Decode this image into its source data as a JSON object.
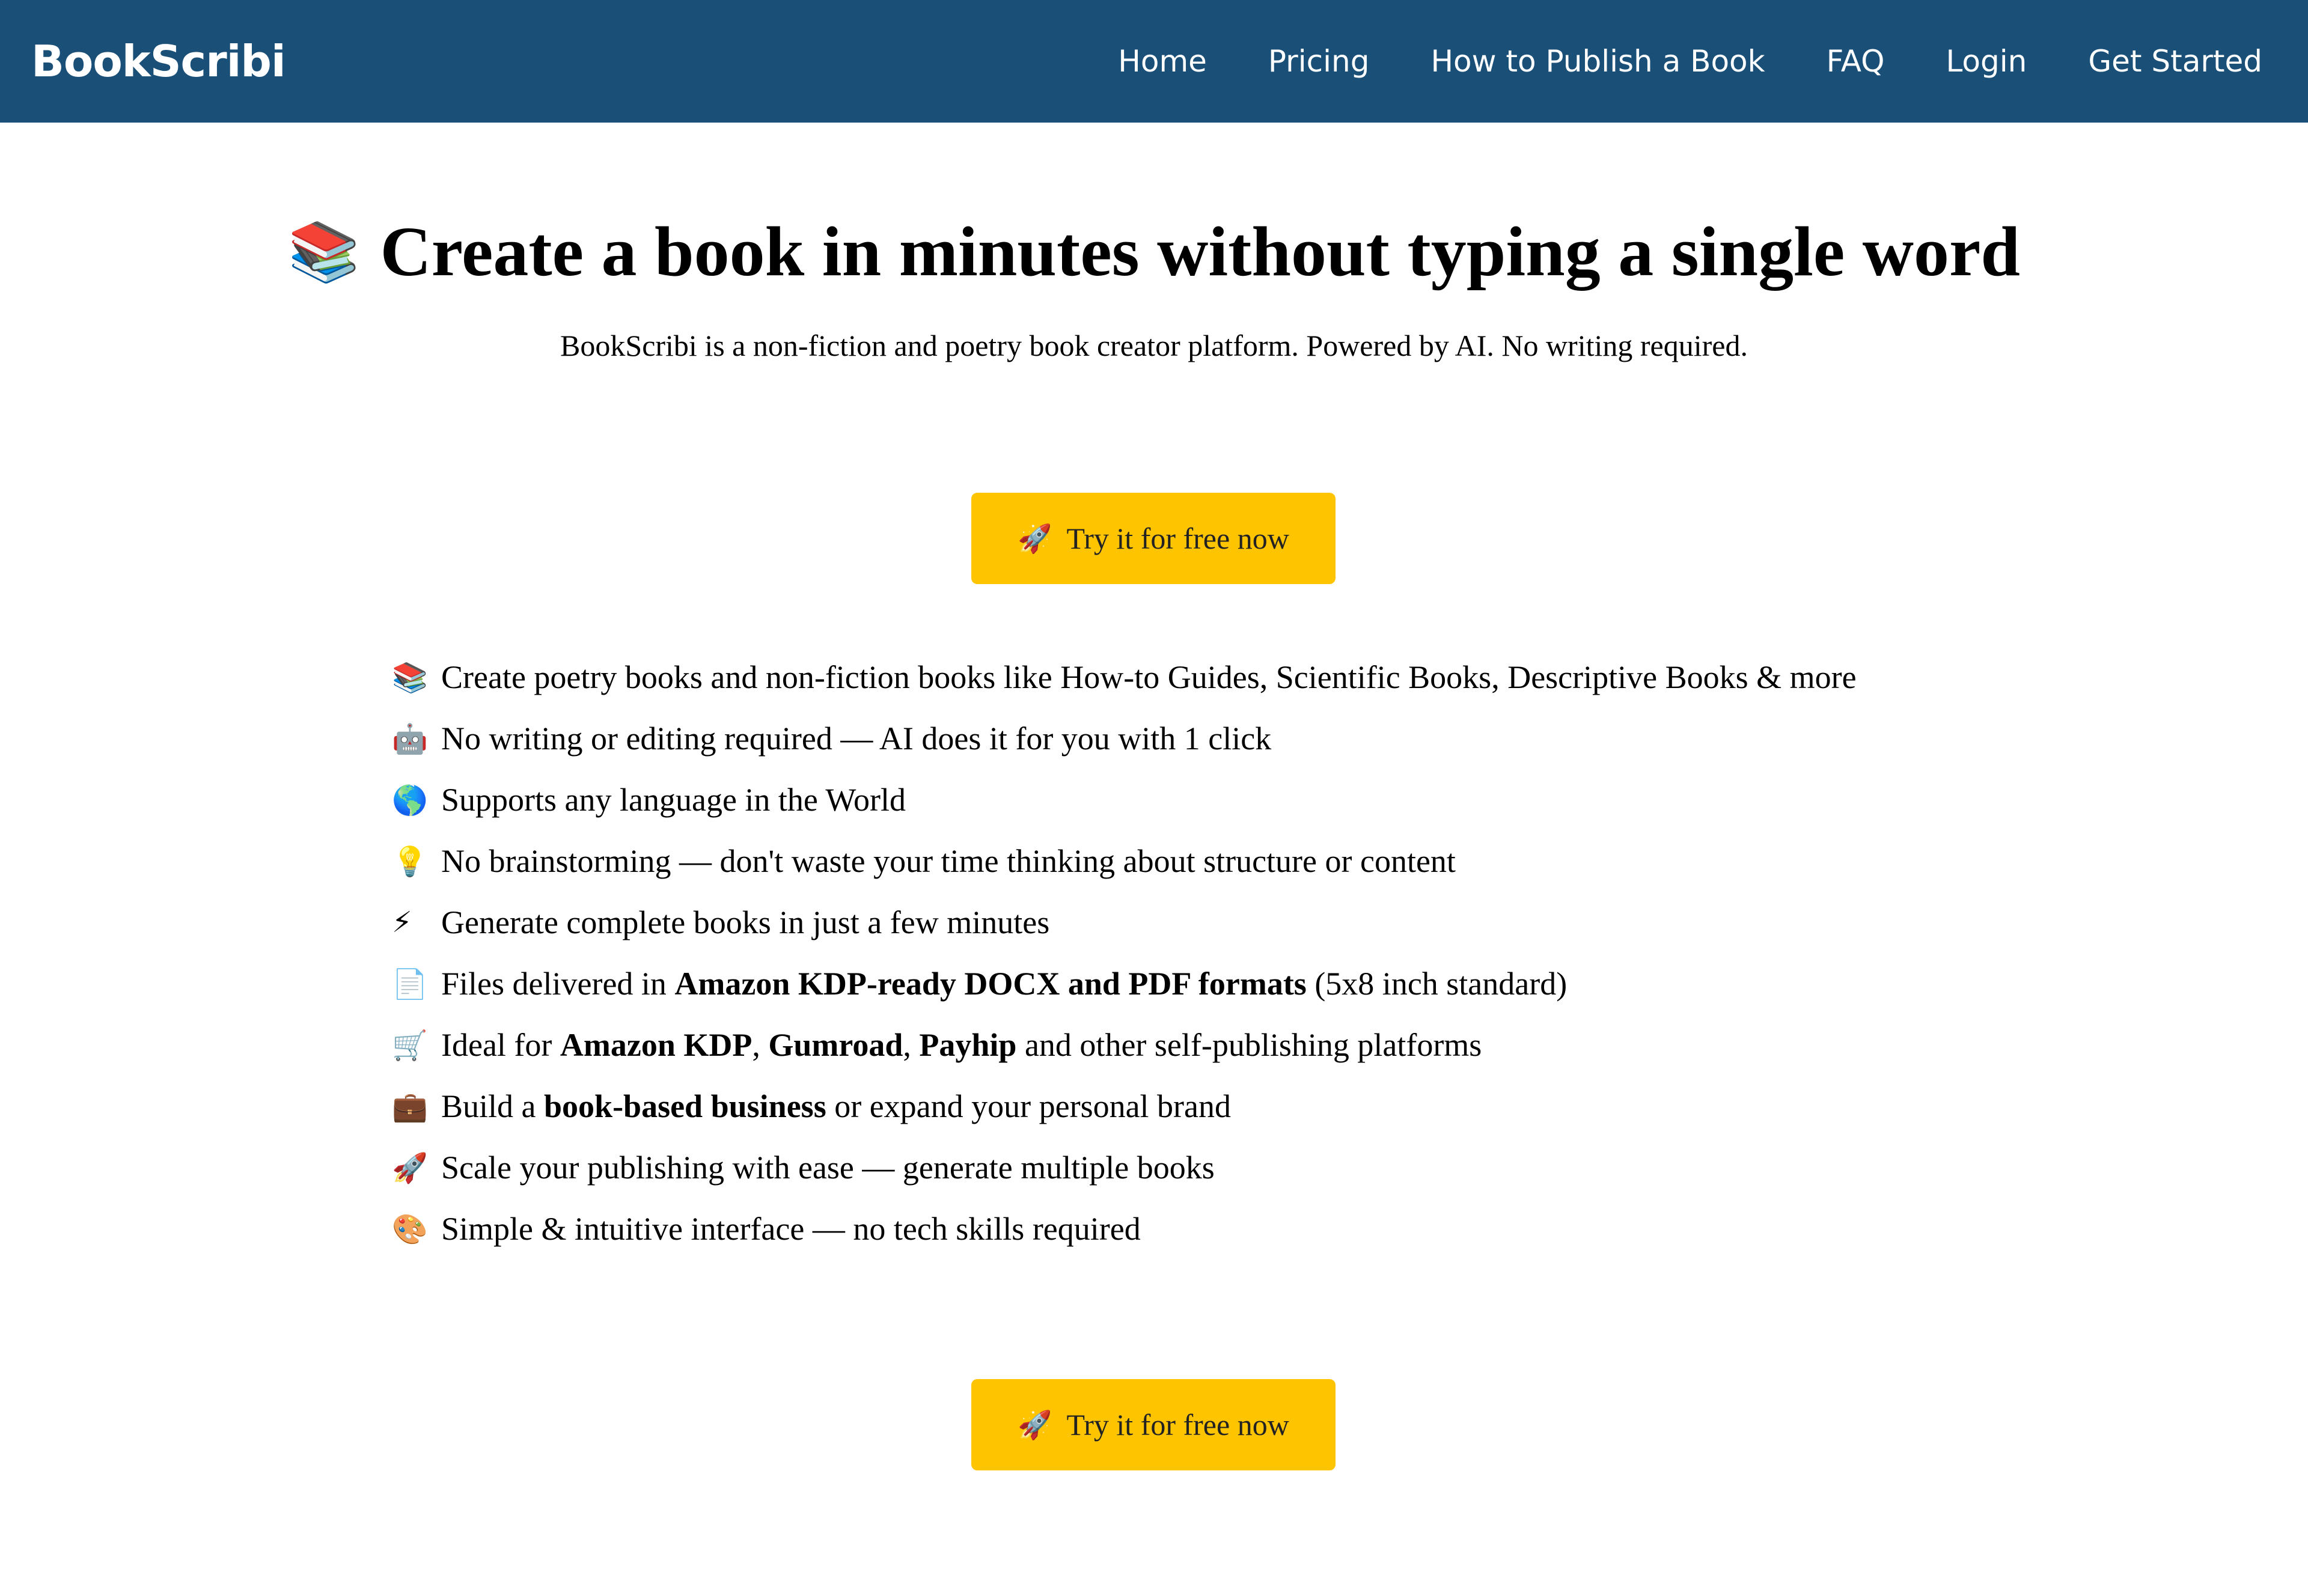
{
  "navbar": {
    "brand": "BookScribi",
    "links": [
      "Home",
      "Pricing",
      "How to Publish a Book",
      "FAQ",
      "Login",
      "Get Started"
    ]
  },
  "hero": {
    "icon": "📚",
    "icon_name": "books-icon",
    "title": "Create a book in minutes without typing a single word",
    "subtitle": "BookScribi is a non-fiction and poetry book creator platform. Powered by AI. No writing required."
  },
  "cta": {
    "icon": "🚀",
    "icon_name": "rocket-icon",
    "label": "Try it for free now",
    "color": "#ffc400"
  },
  "features": [
    {
      "icon": "📚",
      "icon_name": "books-icon",
      "parts": [
        {
          "t": "Create poetry books and non-fiction books like How-to Guides, Scientific Books, Descriptive Books & more"
        }
      ]
    },
    {
      "icon": "🤖",
      "icon_name": "robot-icon",
      "parts": [
        {
          "t": "No writing or editing required — AI does it for you with 1 click"
        }
      ]
    },
    {
      "icon": "🌎",
      "icon_name": "globe-icon",
      "parts": [
        {
          "t": "Supports any language in the World"
        }
      ]
    },
    {
      "icon": "💡",
      "icon_name": "lightbulb-icon",
      "parts": [
        {
          "t": "No brainstorming — don't waste your time thinking about structure or content"
        }
      ]
    },
    {
      "icon": "⚡",
      "icon_name": "lightning-icon",
      "parts": [
        {
          "t": "Generate complete books in just a few minutes"
        }
      ]
    },
    {
      "icon": "📄",
      "icon_name": "document-icon",
      "parts": [
        {
          "t": "Files delivered in "
        },
        {
          "t": "Amazon KDP-ready DOCX and PDF formats",
          "b": true
        },
        {
          "t": " (5x8 inch standard)"
        }
      ]
    },
    {
      "icon": "🛒",
      "icon_name": "shopping-cart-icon",
      "parts": [
        {
          "t": "Ideal for "
        },
        {
          "t": "Amazon KDP",
          "b": true
        },
        {
          "t": ", "
        },
        {
          "t": "Gumroad",
          "b": true
        },
        {
          "t": ", "
        },
        {
          "t": "Payhip",
          "b": true
        },
        {
          "t": " and other self-publishing platforms"
        }
      ]
    },
    {
      "icon": "💼",
      "icon_name": "briefcase-icon",
      "parts": [
        {
          "t": "Build a "
        },
        {
          "t": "book-based business",
          "b": true
        },
        {
          "t": " or expand your personal brand"
        }
      ]
    },
    {
      "icon": "🚀",
      "icon_name": "rocket-icon",
      "parts": [
        {
          "t": "Scale your publishing with ease — generate multiple books"
        }
      ]
    },
    {
      "icon": "🎨",
      "icon_name": "palette-icon",
      "parts": [
        {
          "t": "Simple & intuitive interface — no tech skills required"
        }
      ]
    }
  ],
  "colors": {
    "navbar": "#1a4f78",
    "button": "#ffc400"
  }
}
